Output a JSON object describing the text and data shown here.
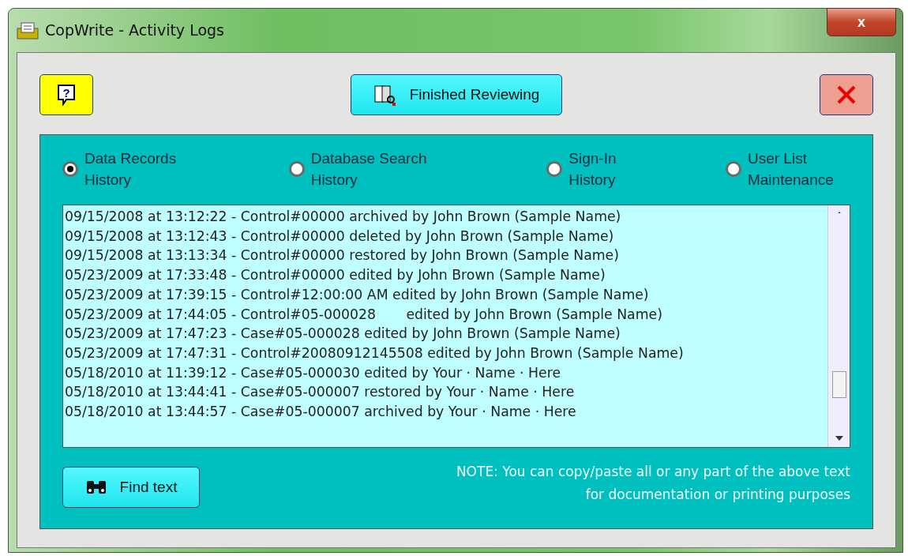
{
  "window": {
    "title": "CopWrite - Activity Logs",
    "close_glyph": "x"
  },
  "toolbar": {
    "help_glyph": "?",
    "finished_button": "Finished Reviewing"
  },
  "log_types": [
    {
      "label": "Data Records History",
      "selected": true
    },
    {
      "label": "Database Search History",
      "selected": false
    },
    {
      "label": "Sign-In History",
      "selected": false
    },
    {
      "label": "User List Maintenance",
      "selected": false
    }
  ],
  "log_lines": [
    "09/15/2008 at 13:12:22 - Control#00000 archived by John Brown (Sample Name)",
    "09/15/2008 at 13:12:43 - Control#00000 deleted by John Brown (Sample Name)",
    "09/15/2008 at 13:13:34 - Control#00000 restored by John Brown (Sample Name)",
    "05/23/2009 at 17:33:48 - Control#00000 edited by John Brown (Sample Name)",
    "05/23/2009 at 17:39:15 - Control#12:00:00 AM edited by John Brown (Sample Name)",
    "05/23/2009 at 17:44:05 - Control#05-000028       edited by John Brown (Sample Name)",
    "05/23/2009 at 17:47:23 - Case#05-000028 edited by John Brown (Sample Name)",
    "05/23/2009 at 17:47:31 - Control#20080912145508 edited by John Brown (Sample Name)",
    "05/18/2010 at 11:39:12 - Case#05-000030 edited by Your · Name · Here",
    "05/18/2010 at 13:44:41 - Case#05-000007 restored by Your · Name · Here",
    "05/18/2010 at 13:44:57 - Case#05-000007 archived by Your · Name · Here"
  ],
  "find_button": "Find text",
  "note": "NOTE: You can copy/paste all or any part of the above text for documentation or printing purposes"
}
